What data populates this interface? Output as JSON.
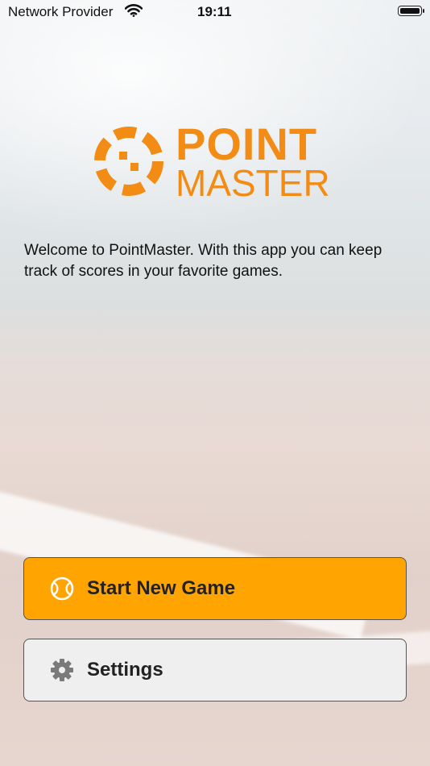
{
  "statusbar": {
    "carrier": "Network Provider",
    "time": "19:11"
  },
  "logo": {
    "line1": "POINT",
    "line2": "MASTER",
    "color": "#f28c14"
  },
  "welcome_text": "Welcome to PointMaster. With this app you can keep track of scores in your favorite games.",
  "buttons": {
    "start": {
      "label": "Start New Game",
      "icon": "tennis-ball-icon",
      "color": "#ffa400"
    },
    "settings": {
      "label": "Settings",
      "icon": "gear-icon",
      "color": "#efefef"
    }
  }
}
